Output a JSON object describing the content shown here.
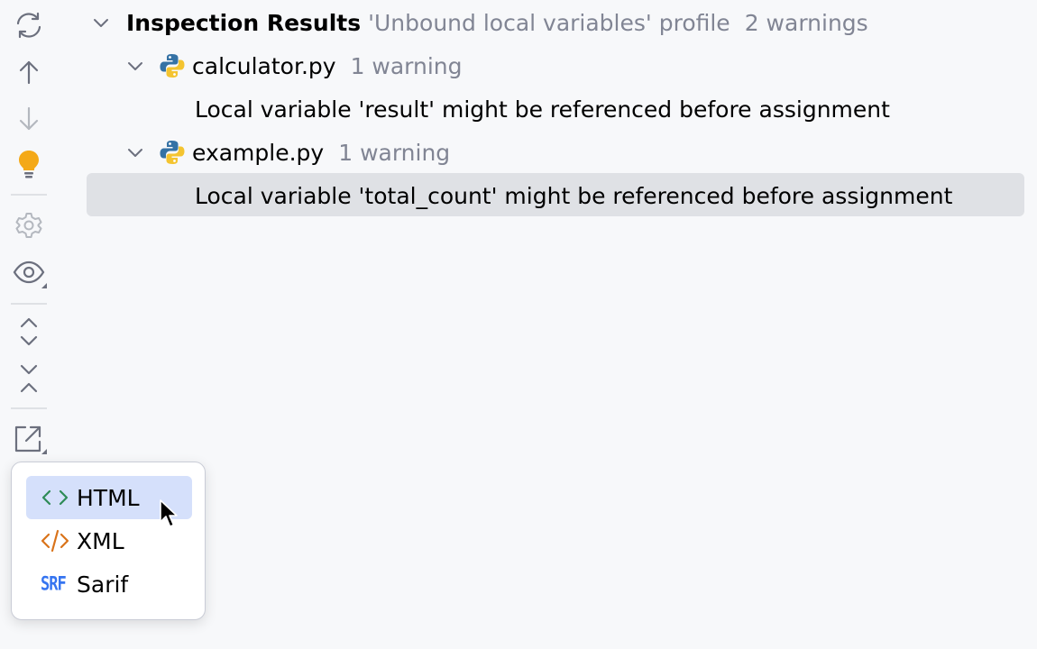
{
  "toolbar": {
    "items": [
      {
        "name": "rerun-icon"
      },
      {
        "name": "previous-icon"
      },
      {
        "name": "next-icon"
      },
      {
        "name": "lightbulb-icon"
      },
      {
        "name": "settings-icon"
      },
      {
        "name": "view-options-icon"
      },
      {
        "name": "expand-all-icon"
      },
      {
        "name": "collapse-all-icon"
      },
      {
        "name": "export-icon"
      }
    ]
  },
  "tree": {
    "root": {
      "title": "Inspection Results",
      "profile": "'Unbound local variables' profile",
      "count": "2 warnings"
    },
    "files": [
      {
        "name": "calculator.py",
        "count": "1 warning",
        "message": "Local variable 'result' might be referenced before assignment"
      },
      {
        "name": "example.py",
        "count": "1 warning",
        "message": "Local variable 'total_count' might be referenced before assignment"
      }
    ]
  },
  "export_menu": {
    "items": [
      {
        "label": "HTML",
        "icon": "html-icon",
        "selected": true
      },
      {
        "label": "XML",
        "icon": "xml-icon"
      },
      {
        "label": "Sarif",
        "icon": "sarif-icon",
        "icon_text": "SRF"
      }
    ]
  },
  "colors": {
    "background": "#f7f8fa",
    "selection": "#dfe1e5",
    "menu_selection": "#d5e0fb",
    "lightbulb": "#f4a918",
    "html_icon": "#2e8b57",
    "xml_icon": "#d9731a",
    "sarif_icon": "#3574f0",
    "python_blue": "#3572a5",
    "python_yellow": "#f4c430"
  }
}
